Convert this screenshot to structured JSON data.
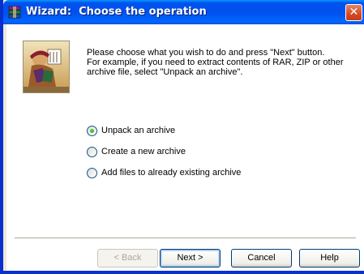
{
  "window": {
    "title": "Wizard:  Choose the operation",
    "close_glyph": "✕"
  },
  "intro": {
    "line1": "Please choose what you wish to do and press \"Next\" button.",
    "line2": "For example, if you need to extract contents of RAR, ZIP or other",
    "line3": "archive file, select \"Unpack an archive\"."
  },
  "options": [
    {
      "label": "Unpack an archive",
      "selected": true
    },
    {
      "label": "Create a new archive",
      "selected": false
    },
    {
      "label": "Add files to already existing archive",
      "selected": false
    }
  ],
  "buttons": {
    "back": "< Back",
    "next": "Next >",
    "cancel": "Cancel",
    "help": "Help"
  },
  "colors": {
    "titlebar": "#0053ee",
    "dialog_bg": "#ece9d8",
    "close_button": "#d44a24"
  }
}
